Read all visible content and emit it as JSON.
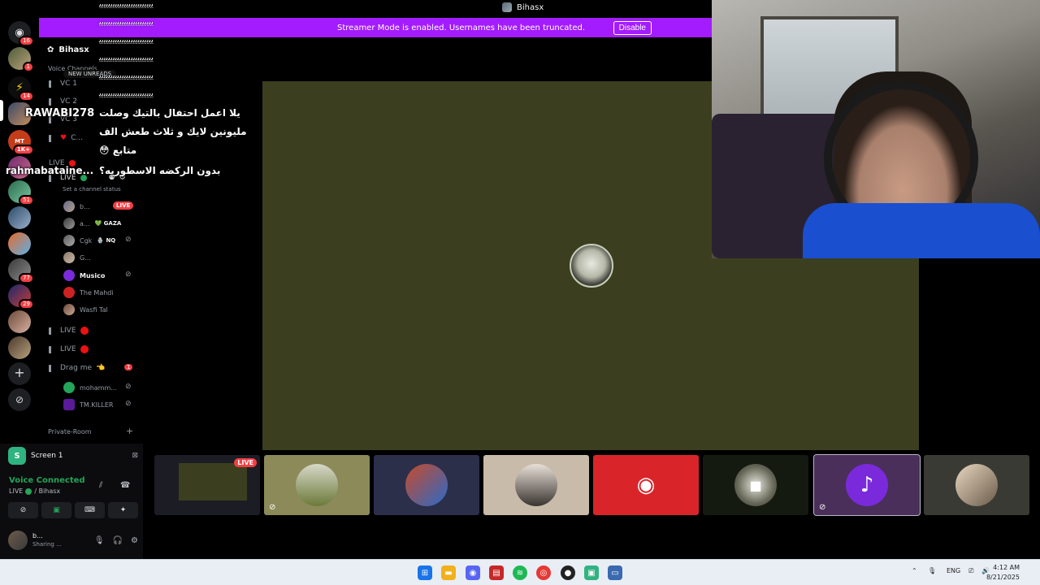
{
  "window": {
    "title": "Bihasx"
  },
  "banner": {
    "message": "Streamer Mode is enabled. Usernames have been truncated.",
    "disable_label": "Disable"
  },
  "rail": {
    "servers": [
      {
        "badge": "16"
      },
      {
        "badge": "1"
      },
      {
        "badge": "14"
      },
      {
        "badge": ""
      },
      {
        "badge": "1K+"
      },
      {
        "badge": ""
      },
      {
        "badge": "51"
      },
      {
        "badge": ""
      },
      {
        "badge": ""
      },
      {
        "badge": "77"
      },
      {
        "badge": "29"
      },
      {
        "badge": ""
      },
      {
        "badge": ""
      }
    ]
  },
  "sidebar": {
    "server_name": "Bihasx",
    "category": "Voice Channels",
    "new_unreads": "NEW UNREADS",
    "channels": {
      "vc1": "VC 1",
      "vc2": "VC 2",
      "vc3": "VC 3",
      "c": "C...",
      "live_top": "LIVE",
      "live_current": "LIVE",
      "status_hint": "Set a channel status",
      "live2": "LIVE",
      "live3": "LIVE",
      "drag": "Drag me",
      "drag_badge": "1",
      "private": "Private-Room"
    },
    "users": [
      {
        "name": "b...",
        "tag": "",
        "live": "LIVE"
      },
      {
        "name": "a...",
        "tag": "💚 GAZA"
      },
      {
        "name": "Cgk",
        "tag": "🪬 NQ"
      },
      {
        "name": "G..."
      },
      {
        "name": "Musico"
      },
      {
        "name": "The Mahdi"
      },
      {
        "name": "Wasfi Tal"
      },
      {
        "name": "mohamm..."
      },
      {
        "name": "TM.KILLER"
      }
    ]
  },
  "overlay": {
    "spam_lines": [
      "ﯾﯾﯾﯾﯾﯾﯾﯾﯾﯾﯾﯾﯾﯾﯾﯾﯾﯾﯾﯾﯾﯾﯾﯾ",
      "ﯾﯾﯾﯾﯾﯾﯾﯾﯾﯾﯾﯾﯾﯾﯾﯾﯾﯾﯾﯾﯾﯾﯾﯾ",
      "ﯾﯾﯾﯾﯾﯾﯾﯾﯾﯾﯾﯾﯾﯾﯾﯾﯾﯾﯾﯾﯾﯾﯾﯾ",
      "ﯾﯾﯾﯾﯾﯾﯾﯾﯾﯾﯾﯾﯾﯾﯾﯾﯾﯾﯾﯾﯾﯾﯾﯾ",
      "ﯾﯾﯾﯾﯾﯾﯾﯾﯾﯾﯾﯾﯾﯾﯾﯾﯾﯾﯾﯾﯾﯾﯾﯾ",
      "ﯾﯾﯾﯾﯾﯾﯾﯾﯾﯾﯾﯾﯾﯾﯾﯾﯾﯾﯾﯾﯾﯾﯾﯾ"
    ],
    "nick1": "RAWABI278",
    "msg1": "يلا اعمل احتفال بالتيك وصلت",
    "msg2": "مليونين لايك و ثلاث طعش الف",
    "msg3": "متابع 😳",
    "nick2": "rahmabataine...",
    "msg4": "بدون الركضه الاسطوريه؟"
  },
  "panel": {
    "screen_label": "Screen 1",
    "voice_connected": "Voice Connected",
    "voice_channel": "LIVE",
    "voice_server": "/ Bihasx",
    "user_name": "b...",
    "user_status": "Sharing ..."
  },
  "taskbar": {
    "lang": "ENG",
    "time": "4:12 AM",
    "date": "8/21/2025"
  },
  "colors": {
    "accent": "#a31cff",
    "live": "#f23f43",
    "connected": "#23a55a",
    "stage": "#3b3f1f"
  }
}
